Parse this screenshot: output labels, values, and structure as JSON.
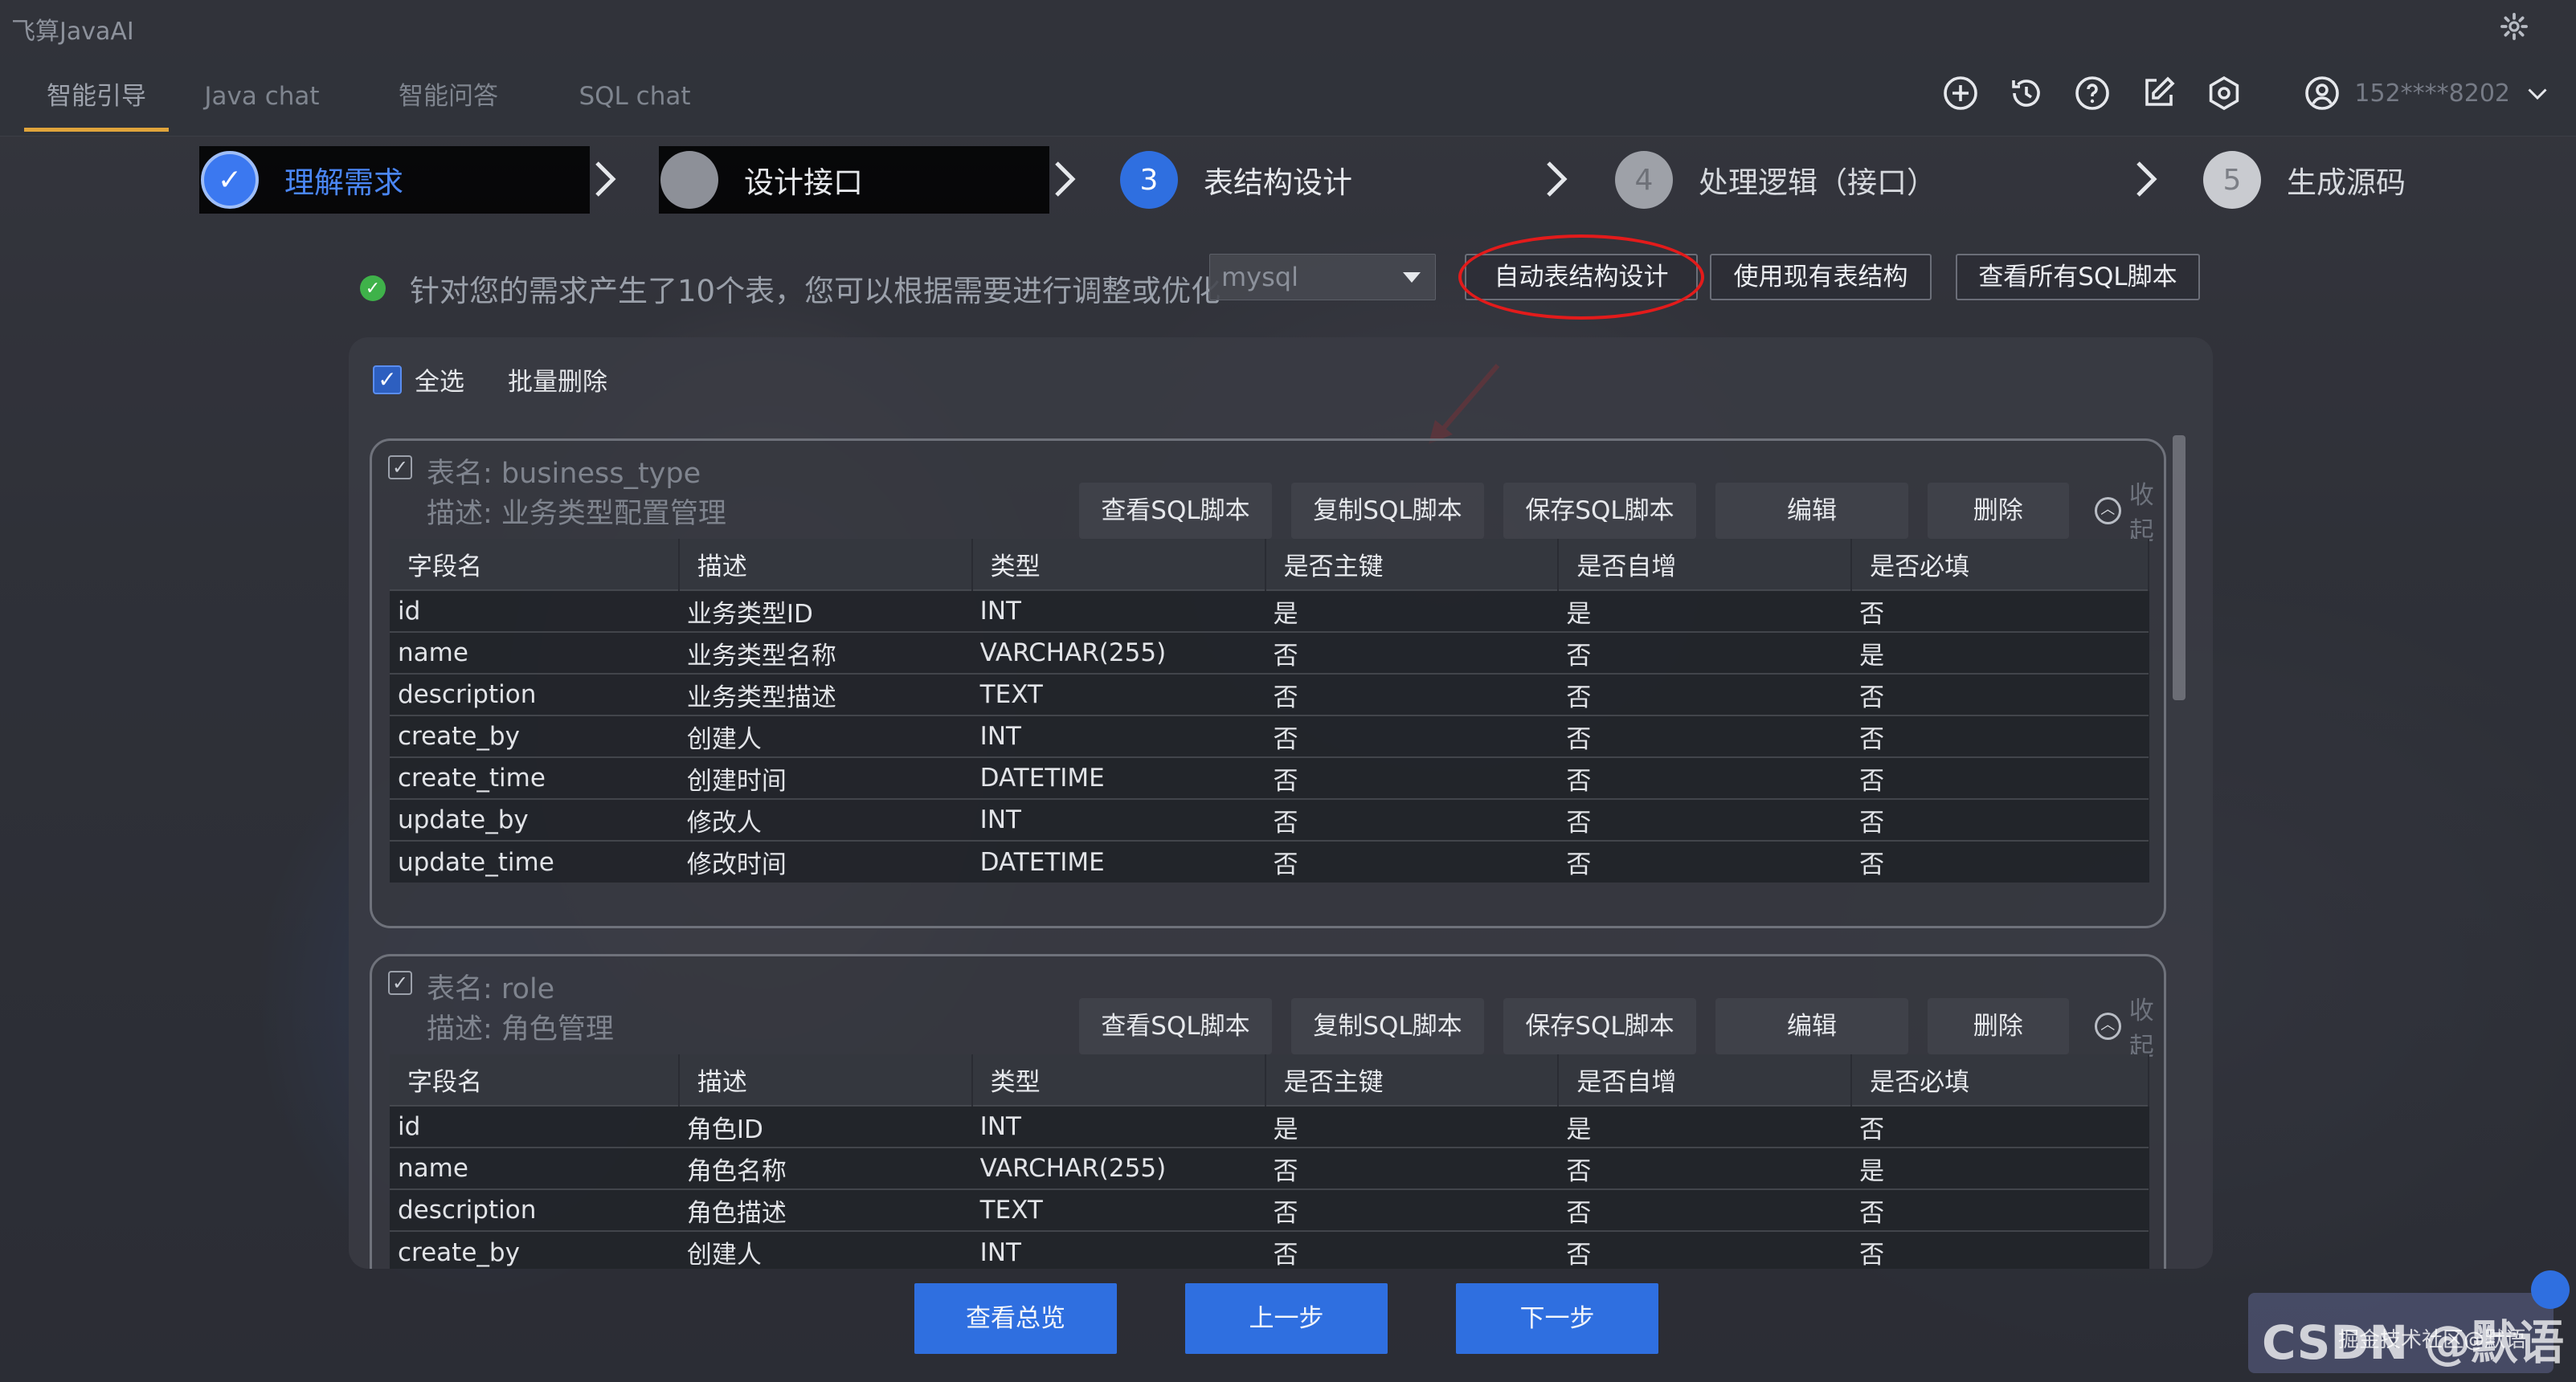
{
  "app": {
    "title": "飞算JavaAI"
  },
  "nav": {
    "tabs": [
      "智能引导",
      "Java chat",
      "智能问答",
      "SQL chat"
    ],
    "active_index": 0
  },
  "user": {
    "phone": "152****8202"
  },
  "steps": [
    {
      "index": "✓",
      "label": "理解需求",
      "state": "done"
    },
    {
      "index": "",
      "label": "设计接口",
      "state": "done"
    },
    {
      "index": "3",
      "label": "表结构设计",
      "state": "active"
    },
    {
      "index": "4",
      "label": "处理逻辑（接口）",
      "state": "pending"
    },
    {
      "index": "5",
      "label": "生成源码",
      "state": "pending"
    }
  ],
  "message": "针对您的需求产生了10个表，您可以根据需要进行调整或优化",
  "db_select": {
    "value": "mysql"
  },
  "toolbar": {
    "auto_design": "自动表结构设计",
    "use_existing": "使用现有表结构",
    "view_all_sql": "查看所有SQL脚本"
  },
  "panel": {
    "select_all": "全选",
    "batch_delete": "批量删除"
  },
  "card_actions": {
    "view_sql": "查看SQL脚本",
    "copy_sql": "复制SQL脚本",
    "save_sql": "保存SQL脚本",
    "edit": "编辑",
    "delete": "删除",
    "collapse": "收起"
  },
  "columns": [
    "字段名",
    "描述",
    "类型",
    "是否主键",
    "是否自增",
    "是否必填"
  ],
  "tables": [
    {
      "name": "表名: business_type",
      "desc": "描述: 业务类型配置管理",
      "rows": [
        [
          "id",
          "业务类型ID",
          "INT",
          "是",
          "是",
          "否"
        ],
        [
          "name",
          "业务类型名称",
          "VARCHAR(255)",
          "否",
          "否",
          "是"
        ],
        [
          "description",
          "业务类型描述",
          "TEXT",
          "否",
          "否",
          "否"
        ],
        [
          "create_by",
          "创建人",
          "INT",
          "否",
          "否",
          "否"
        ],
        [
          "create_time",
          "创建时间",
          "DATETIME",
          "否",
          "否",
          "否"
        ],
        [
          "update_by",
          "修改人",
          "INT",
          "否",
          "否",
          "否"
        ],
        [
          "update_time",
          "修改时间",
          "DATETIME",
          "否",
          "否",
          "否"
        ]
      ]
    },
    {
      "name": "表名: role",
      "desc": "描述: 角色管理",
      "rows": [
        [
          "id",
          "角色ID",
          "INT",
          "是",
          "是",
          "否"
        ],
        [
          "name",
          "角色名称",
          "VARCHAR(255)",
          "否",
          "否",
          "是"
        ],
        [
          "description",
          "角色描述",
          "TEXT",
          "否",
          "否",
          "否"
        ],
        [
          "create_by",
          "创建人",
          "INT",
          "否",
          "否",
          "否"
        ]
      ]
    }
  ],
  "bottom": {
    "overview": "查看总览",
    "prev": "上一步",
    "next": "下一步"
  },
  "watermark": {
    "text": "CSDN @默语",
    "sub": "掘金技术社区@默语"
  },
  "colors": {
    "accent": "#2f6fe0",
    "tab_underline": "#e0a43b",
    "ok": "#3fb24a",
    "highlight": "#e31b1b"
  }
}
